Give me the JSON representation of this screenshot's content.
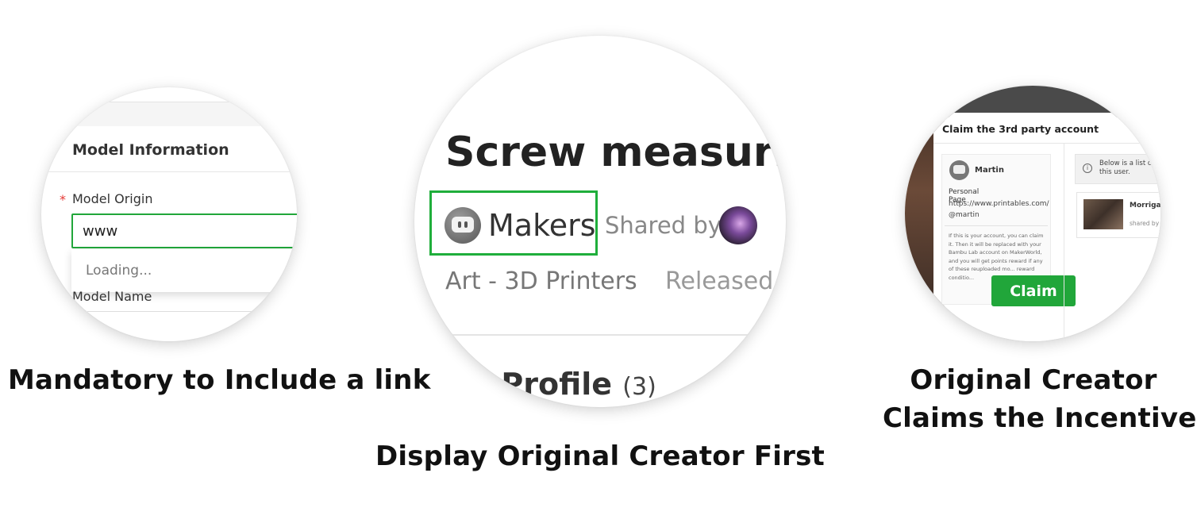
{
  "panel1": {
    "section_title": "Model Information",
    "required_mark": "*",
    "origin_label": "Model Origin",
    "origin_value": "www",
    "dropdown_status": "Loading...",
    "name_label": "Model Name",
    "caption": "Mandatory to Include a link"
  },
  "panel2": {
    "model_title": "Screw measurin",
    "maker_name": "Makers",
    "shared_by": "Shared by",
    "category": "Art - 3D Printers",
    "released": "Released",
    "profile_label": "t Profile",
    "profile_count": "(3)",
    "caption": "Display Original Creator First"
  },
  "panel3": {
    "modal_title": "Claim the 3rd party account",
    "user_name": "Martin",
    "personal_page_label": "Personal Page",
    "personal_page_url": "https://www.printables.com/",
    "personal_page_handle": "@martin",
    "claim_text": "If this is your account, you can claim it. Then it will be replaced with your Bambu Lab account on MakerWorld, and you will get points reward if any of these reuploaded mo... reward conditio...",
    "claim_button": "Claim",
    "info_text": "Below is a list o... this user.",
    "list_item_name": "Morrigan",
    "list_item_shared": "shared by",
    "caption_line1": "Original Creator",
    "caption_line2": "Claims the Incentives"
  },
  "colors": {
    "accent_green": "#21a63a",
    "required_red": "#e53935"
  }
}
